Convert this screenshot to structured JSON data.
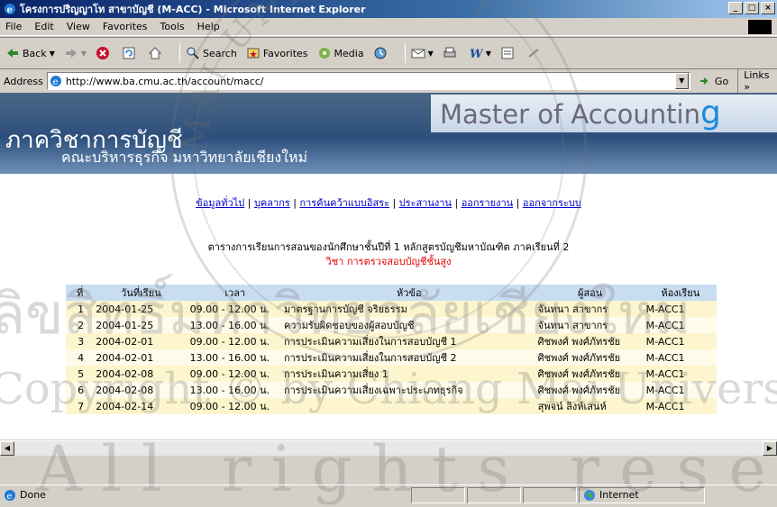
{
  "window": {
    "title": "โครงการปริญญาโท สาขาบัญชี (M-ACC) - Microsoft Internet Explorer",
    "buttons": [
      "_",
      "□",
      "×"
    ]
  },
  "menu": [
    "File",
    "Edit",
    "View",
    "Favorites",
    "Tools",
    "Help"
  ],
  "toolbar": {
    "back": "Back",
    "search": "Search",
    "favorites": "Favorites",
    "media": "Media"
  },
  "address": {
    "label": "Address",
    "url": "http://www.ba.cmu.ac.th/account/macc/",
    "go": "Go",
    "links": "Links »"
  },
  "banner": {
    "department": "ภาควิชาการบัญชี",
    "faculty": "คณะบริหารธุรกิจ มหาวิทยาลัยเชียงใหม่",
    "master_text": "Master of Accountin",
    "master_last": "g"
  },
  "nav": {
    "items": [
      "ข้อมูลทั่วไป",
      "บุคลากร",
      "การค้นคว้าแบบอิสระ",
      "ประสานงาน",
      "ออกรายงาน",
      "ออกจากระบบ"
    ]
  },
  "schedule": {
    "title": "ตารางการเรียนการสอนของนักศึกษาชั้นปีที่ 1 หลักสูตรบัญชีมหาบัณฑิต ภาคเรียนที่ 2",
    "subject": "วิชา การตรวจสอบบัญชีชั้นสูง",
    "headers": [
      "ที่",
      "วันที่เรียน",
      "เวลา",
      "หัวข้อ",
      "ผู้สอน",
      "ห้องเรียน"
    ],
    "rows": [
      [
        "1",
        "2004-01-25",
        "09.00 - 12.00 น.",
        "มาตรฐานการบัญชี จริยธรรม",
        "จันทนา สาขากร",
        "M-ACC1"
      ],
      [
        "2",
        "2004-01-25",
        "13.00 - 16.00 น.",
        "ความรับผิดชอบของผู้สอบบัญชี",
        "จันทนา สาขากร",
        "M-ACC1"
      ],
      [
        "3",
        "2004-02-01",
        "09.00 - 12.00 น.",
        "การประเมินความเสี่ยงในการสอบบัญชี 1",
        "ศิชพงศ์ พงศ์ภัทรชัย",
        "M-ACC1"
      ],
      [
        "4",
        "2004-02-01",
        "13.00 - 16.00 น.",
        "การประเมินความเสี่ยงในการสอบบัญชี 2",
        "ศิชพงศ์ พงศ์ภัทรชัย",
        "M-ACC1"
      ],
      [
        "5",
        "2004-02-08",
        "09.00 - 12.00 น.",
        "การประเมินความเสี่ยง 1",
        "ศิชพงศ์ พงศ์ภัทรชัย",
        "M-ACC1"
      ],
      [
        "6",
        "2004-02-08",
        "13.00 - 16.00 น.",
        "การประเมินความเสี่ยงเฉพาะประเภทธุรกิจ",
        "ศิชพงศ์ พงศ์ภัทรชัย",
        "M-ACC1"
      ],
      [
        "7",
        "2004-02-14",
        "09.00 - 12.00 น.",
        "",
        "สุพจน์ ลิงห์เสนห์",
        "M-ACC1"
      ]
    ]
  },
  "status": {
    "text": "Done",
    "zone": "Internet"
  },
  "watermark": {
    "line1": "ลิขสิทธิ์มหาวิทยาลัยเชียงใหม่",
    "line2": "Copyright © by Chiang Mai University",
    "line3": "All rights reserved",
    "arc_top": "MAI UNIVERSITY"
  },
  "colors": {
    "title_gradient_start": "#0a246a",
    "banner_blue": "#2c4f7c",
    "link_blue": "#0000cc",
    "subject_red": "#e60000",
    "header_row": "#c9ddf2",
    "row_odd": "#fdf5cd",
    "row_even": "#fffbea",
    "accent_g": "#1a8adc"
  }
}
